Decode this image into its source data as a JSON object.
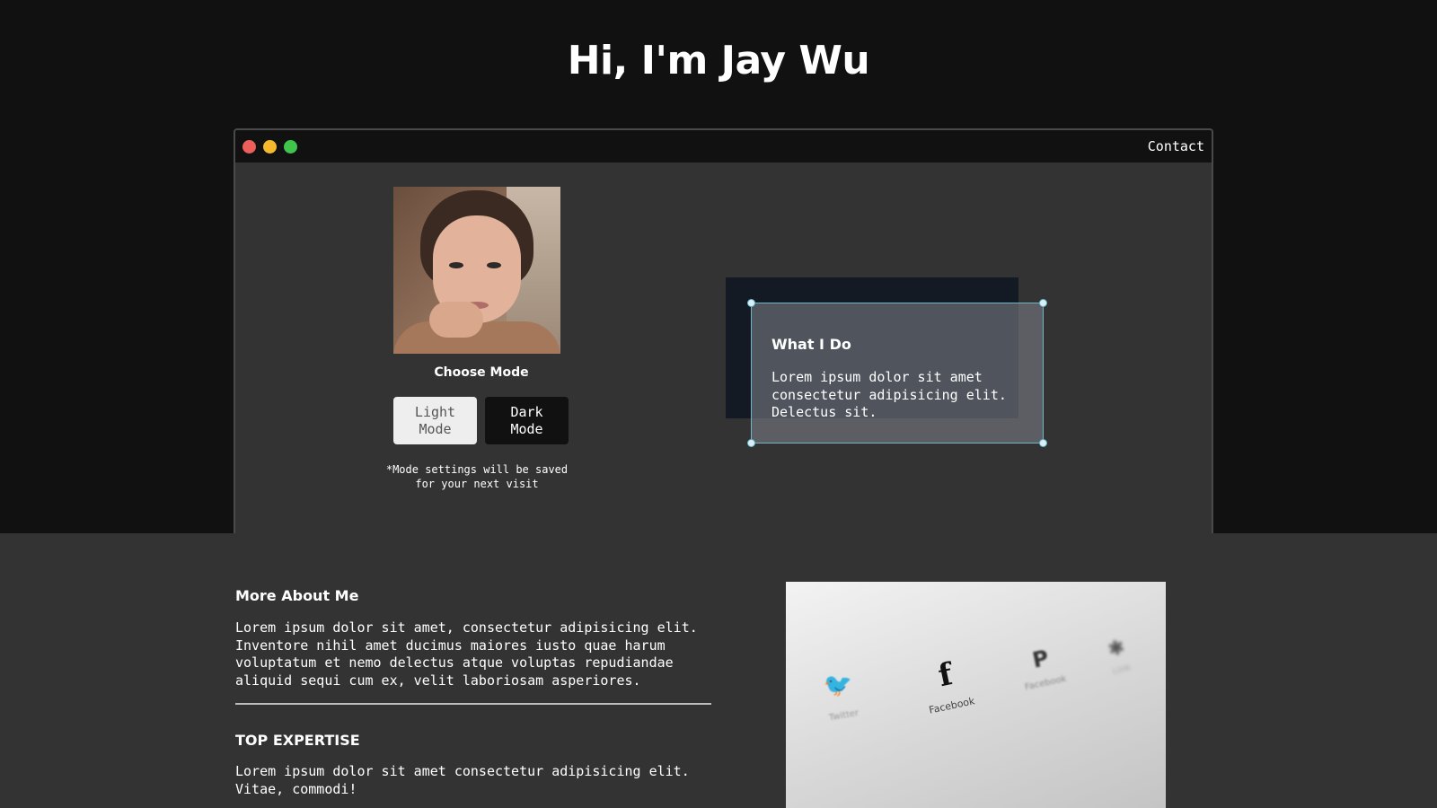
{
  "hero": {
    "title": "Hi, I'm Jay Wu"
  },
  "window": {
    "controls": [
      "close",
      "minimize",
      "maximize"
    ],
    "nav_contact": "Contact"
  },
  "profile": {
    "photo_alt": "portrait-photo",
    "choose_mode_label": "Choose Mode",
    "light_mode_label": "Light\nMode",
    "dark_mode_label": "Dark\nMode",
    "mode_note": "*Mode settings will be saved for your next visit"
  },
  "what_i_do": {
    "title": "What I Do",
    "text": "Lorem ipsum dolor sit amet consectetur adipisicing elit. Delectus sit."
  },
  "more_about": {
    "title": "More About Me",
    "text": "Lorem ipsum dolor sit amet, consectetur adipisicing elit. Inventore nihil amet ducimus maiores iusto quae harum voluptatum et nemo delectus atque voluptas repudiandae aliquid sequi cum ex, velit laboriosam asperiores."
  },
  "top_expertise": {
    "title": "TOP EXPERTISE",
    "text": "Lorem ipsum dolor sit amet consectetur adipisicing elit. Vitae, commodi!"
  },
  "social_image": {
    "items": [
      {
        "icon": "twitter-bird-icon",
        "glyph": "🐦",
        "label": "Twitter"
      },
      {
        "icon": "facebook-icon",
        "glyph": "f",
        "label": "Facebook"
      },
      {
        "icon": "pinterest-icon",
        "glyph": "P",
        "label": "Facebook"
      },
      {
        "icon": "social-icon",
        "glyph": "✱",
        "label": "Link"
      }
    ]
  },
  "colors": {
    "hero_bg": "#111111",
    "page_bg": "#333333",
    "window_close": "#ed5f5a",
    "window_minimize": "#f5b82c",
    "window_maximize": "#3fc54b",
    "card_accent": "#6fb6c8"
  }
}
